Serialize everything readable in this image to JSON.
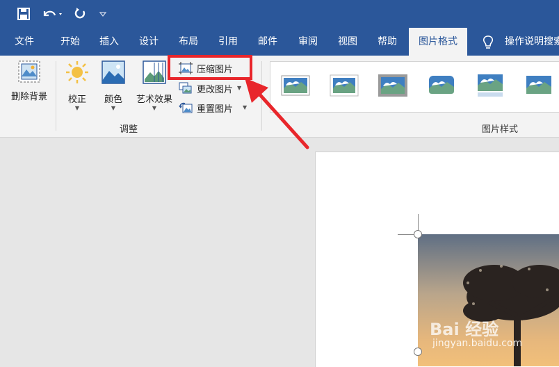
{
  "tabs": [
    "文件",
    "开始",
    "插入",
    "设计",
    "布局",
    "引用",
    "邮件",
    "审阅",
    "视图",
    "帮助",
    "图片格式"
  ],
  "active_tab": "图片格式",
  "tell_me": "操作说明搜索",
  "ribbon": {
    "remove_bg": "删除背景",
    "corrections": "校正",
    "color": "颜色",
    "artistic": "艺术效果",
    "compress": "压缩图片",
    "change": "更改图片",
    "reset": "重置图片",
    "group_adjust": "调整",
    "group_styles": "图片样式"
  },
  "watermark": {
    "brand": "Bai 经验",
    "url": "jingyan.baidu.com"
  },
  "colors": {
    "accent": "#2b579a",
    "highlight": "#e8262b"
  }
}
